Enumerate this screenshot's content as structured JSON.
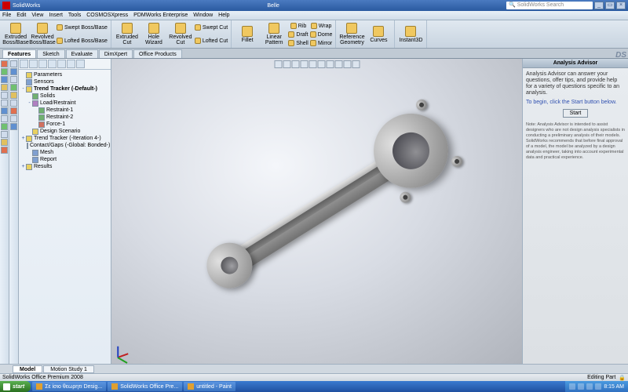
{
  "title": "SolidWorks",
  "center_text": "Belle",
  "search_placeholder": "SolidWorks Search",
  "menu": [
    "File",
    "Edit",
    "View",
    "Insert",
    "Tools",
    "COSMOSXpress",
    "PDMWorks Enterprise",
    "Window",
    "Help"
  ],
  "ribbon": {
    "g1_big": [
      {
        "l": "Extruded Boss/Base"
      },
      {
        "l": "Revolved Boss/Base"
      }
    ],
    "g1_sm": [
      {
        "l": "Swept Boss/Base"
      },
      {
        "l": "Lofted Boss/Base"
      }
    ],
    "g2_big": [
      {
        "l": "Extruded Cut"
      },
      {
        "l": "Hole Wizard"
      },
      {
        "l": "Revolved Cut"
      }
    ],
    "g2_sm": [
      {
        "l": "Swept Cut"
      },
      {
        "l": "Lofted Cut"
      }
    ],
    "g3_big": [
      {
        "l": "Fillet"
      },
      {
        "l": "Linear Pattern"
      }
    ],
    "g3_sm": [
      {
        "l": "Rib"
      },
      {
        "l": "Draft"
      },
      {
        "l": "Shell"
      },
      {
        "l": "Wrap"
      },
      {
        "l": "Dome"
      },
      {
        "l": "Mirror"
      }
    ],
    "g4": [
      {
        "l": "Reference Geometry"
      },
      {
        "l": "Curves"
      }
    ],
    "g5": [
      {
        "l": "Instant3D"
      }
    ]
  },
  "tabs": [
    "Features",
    "Sketch",
    "Evaluate",
    "DimXpert",
    "Office Products"
  ],
  "active_tab": "Features",
  "tree": [
    {
      "d": 0,
      "e": "",
      "c": "y",
      "l": "Parameters"
    },
    {
      "d": 0,
      "e": "",
      "c": "b",
      "l": "Sensors"
    },
    {
      "d": 0,
      "e": "-",
      "c": "y",
      "l": "Trend Tracker (-Default-)",
      "bold": true
    },
    {
      "d": 1,
      "e": "",
      "c": "g",
      "l": "Solids"
    },
    {
      "d": 1,
      "e": "-",
      "c": "p",
      "l": "Load/Restraint"
    },
    {
      "d": 2,
      "e": "",
      "c": "g",
      "l": "Restraint-1"
    },
    {
      "d": 2,
      "e": "",
      "c": "g",
      "l": "Restraint-2"
    },
    {
      "d": 2,
      "e": "",
      "c": "r",
      "l": "Force-1"
    },
    {
      "d": 1,
      "e": "",
      "c": "y",
      "l": "Design Scenario"
    },
    {
      "d": 0,
      "e": "+",
      "c": "y",
      "l": "Trend Tracker (-Iteration 4-)"
    },
    {
      "d": 1,
      "e": "",
      "c": "b",
      "l": "Contact/Gaps (-Global: Bonded-)"
    },
    {
      "d": 1,
      "e": "",
      "c": "b",
      "l": "Mesh"
    },
    {
      "d": 1,
      "e": "",
      "c": "b",
      "l": "Report"
    },
    {
      "d": 0,
      "e": "+",
      "c": "y",
      "l": "Results"
    }
  ],
  "advisor": {
    "title": "Analysis Advisor",
    "intro": "Analysis Advisor can answer your questions, offer tips, and provide help for a variety of questions specific to an analysis.",
    "prompt": "To begin, click the Start button below.",
    "start": "Start",
    "note": "Note: Analysis Advisor is intended to assist designers who are not design analysis specialists in conducting a preliminary analysis of their models. SolidWorks recommends that before final approval of a model, the model be analyzed by a design analysis engineer, taking into account experimental data and practical experience."
  },
  "bottom_tabs": [
    "Model",
    "Motion Study 1"
  ],
  "active_btab": "Model",
  "status_left": "SolidWorks Office Premium 2008",
  "status_right": "Editing Part",
  "taskbar": {
    "start": "start",
    "items": [
      "Σε ίσιο θεωρητι Desig...",
      "SolidWorks Office Pre...",
      "untitled - Paint"
    ],
    "time": "8:15 AM"
  }
}
